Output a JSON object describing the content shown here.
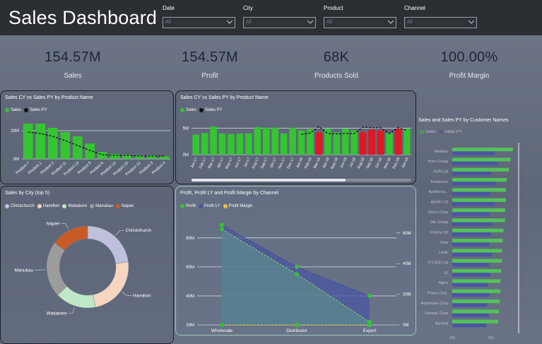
{
  "header": {
    "title": "Sales Dashboard"
  },
  "filters": [
    {
      "label": "Date",
      "value": "All"
    },
    {
      "label": "City",
      "value": "All"
    },
    {
      "label": "Product",
      "value": "All"
    },
    {
      "label": "Channel",
      "value": "All"
    }
  ],
  "kpis": [
    {
      "value": "154.57M",
      "label": "Sales"
    },
    {
      "value": "154.57M",
      "label": "Profit"
    },
    {
      "value": "68K",
      "label": "Products Sold"
    },
    {
      "value": "100.00%",
      "label": "Profit Margin"
    }
  ],
  "colors": {
    "green": "#35c432",
    "red": "#e01822",
    "pyline": "#111111",
    "navy": "#4a55a2",
    "yellow": "#e3c53a"
  },
  "chart_data": [
    {
      "type": "bar",
      "title": "Sales CY vs Sales PY by Product Name",
      "legend": [
        "Sales",
        "Sales PY"
      ],
      "categories": [
        "Product 7",
        "Product 1",
        "Product 2",
        "Product 11",
        "Product 13",
        "Product 8",
        "Product 6",
        "Product 14",
        "Product 10",
        "Product 12",
        "Product 3",
        "Product 4"
      ],
      "series": [
        {
          "name": "Sales",
          "values": [
            25,
            25,
            22,
            19,
            16,
            11,
            5,
            3.5,
            3,
            2.5,
            2.5,
            2
          ]
        },
        {
          "name": "Sales PY",
          "values": [
            19,
            18,
            16,
            13,
            9.5,
            6,
            3,
            2.5,
            2.5,
            2,
            2,
            2
          ]
        }
      ],
      "yticks": [
        "0M",
        "20M"
      ],
      "ylim": [
        0,
        28
      ]
    },
    {
      "type": "bar",
      "title": "Sales CY vs Sales PY by Product Name",
      "legend": [
        "Sales",
        "Sales PY"
      ],
      "categories": [
        "Jan-17",
        "Feb-17",
        "Mar-17",
        "Apr-17",
        "May-17",
        "Jun-17",
        "Jul-17",
        "Aug-17",
        "Sep-17",
        "Oct-17",
        "Nov-17",
        "Dec-17",
        "Jan-18",
        "Feb-18",
        "Mar-18",
        "Apr-18",
        "May-18",
        "Jun-18",
        "Jul-18",
        "Aug-18",
        "Sep-18",
        "Oct-18",
        "Nov-18",
        "Dec-18",
        "Jan-19"
      ],
      "series": [
        {
          "name": "Sales",
          "values": [
            3.8,
            4.1,
            5.3,
            4.0,
            3.9,
            4.0,
            4.0,
            5.2,
            5.1,
            5.1,
            4.0,
            5.1,
            4.6,
            4.8,
            4.2,
            4.9,
            4.2,
            4.9,
            4.6,
            4.3,
            4.7,
            4.6,
            4.1,
            4.9,
            4.9
          ]
        },
        {
          "name": "Sales PY",
          "values": [
            null,
            null,
            null,
            null,
            null,
            null,
            null,
            null,
            null,
            null,
            null,
            null,
            3.8,
            4.1,
            5.3,
            4.0,
            3.9,
            4.0,
            4.0,
            5.2,
            5.1,
            5.1,
            4.0,
            5.1,
            4.6
          ]
        }
      ],
      "below_py": [
        14,
        19,
        20,
        21,
        23
      ],
      "yticks": [
        "0M",
        "5M"
      ],
      "ylim": [
        0,
        6.4
      ]
    },
    {
      "type": "pie",
      "title": "Sales by City (top 5)",
      "legend": [
        "Christchurch",
        "Hamilton",
        "Waitakere",
        "Manukau",
        "Napier"
      ],
      "categories": [
        "Christchurch",
        "Hamilton",
        "Waitakere",
        "Manukau",
        "Napier"
      ],
      "values": [
        23,
        24,
        16,
        22,
        15
      ],
      "colors": [
        "#bfc1dc",
        "#f6d6c0",
        "#bfe8c6",
        "#9c9c9c",
        "#c85b24"
      ]
    },
    {
      "type": "area",
      "title": "Profit, Profit LY and Profit Margin by Channel",
      "legend": [
        "Profit",
        "Profit LY",
        "Profit Margin"
      ],
      "categories": [
        "Wholesale",
        "Distributor",
        "Export"
      ],
      "series": [
        {
          "name": "Profit",
          "values": [
            86,
            55,
            22
          ]
        },
        {
          "name": "Profit LY",
          "values": [
            89,
            60,
            40
          ]
        },
        {
          "name": "Profit Margin",
          "values": [
            0,
            0,
            0
          ]
        }
      ],
      "yticks_left": [
        "20M",
        "40M",
        "60M",
        "80M"
      ],
      "ylim": [
        20,
        95
      ],
      "yticks_right": [
        "0M",
        "20M",
        "40M",
        "60M"
      ]
    },
    {
      "type": "bar",
      "title": "Sales and Sales PY by Customer Names",
      "legend": [
        "Sales",
        "Sales PY"
      ],
      "categories": [
        "Medline",
        "Pure Group",
        "OUR Ltd",
        "Eminence",
        "Apotheca...",
        "Apollo Ltd",
        "Ohio's Corp",
        "Ole Group",
        "Victory Ltd",
        "Ohio",
        "Linde",
        "ETUDE Ltd",
        "Ei",
        "Nipro",
        "Prasco Grp.",
        "Rochester Corp",
        "Fenwal, Corp",
        "Sundial"
      ],
      "series": [
        {
          "name": "Sales",
          "values": [
            7.8,
            7.5,
            7.3,
            7.0,
            6.9,
            6.9,
            6.8,
            6.8,
            6.6,
            6.5,
            6.4,
            6.4,
            6.3,
            6.2,
            6.2,
            6.1,
            6.0,
            5.9
          ]
        },
        {
          "name": "Sales PY",
          "values": [
            5.5,
            5.8,
            5.0,
            5.6,
            4.9,
            5.5,
            4.8,
            5.2,
            5.0,
            4.8,
            5.1,
            4.7,
            4.9,
            4.6,
            4.8,
            4.5,
            4.7,
            4.4
          ]
        }
      ],
      "xticks": [
        "0M",
        "5M"
      ],
      "xlim": [
        0,
        10
      ]
    }
  ]
}
